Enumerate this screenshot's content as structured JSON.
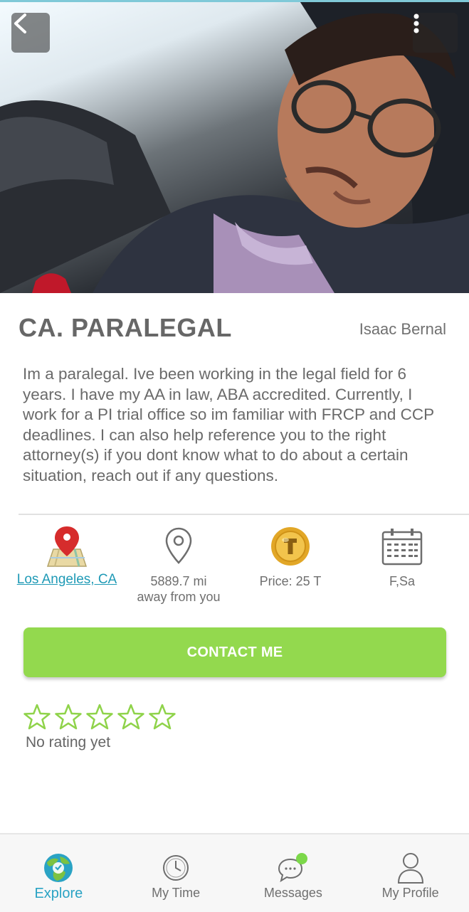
{
  "header": {
    "back_icon": "chevron-left-icon",
    "more_icon": "more-vertical-icon"
  },
  "service": {
    "title": "CA. PARALEGAL",
    "provider": "Isaac Bernal",
    "description": "Im a paralegal. Ive been working in the legal field for 6 years. I have my AA in law, ABA accredited. Currently, I work for a PI trial office so im familiar with FRCP and CCP deadlines. I can also help reference you to the right attorney(s) if you dont know what to do about a certain situation, reach out if any questions."
  },
  "info": {
    "location": "Los Angeles, CA",
    "distance_line1": "5889.7 mi",
    "distance_line2": "away from you",
    "price": "Price: 25 T",
    "days": "F,Sa"
  },
  "contact": {
    "label": "CONTACT ME"
  },
  "rating": {
    "stars_filled": 0,
    "stars_total": 5,
    "text": "No rating yet"
  },
  "nav": {
    "items": [
      {
        "label": "Explore",
        "icon": "explore-globe-icon",
        "active": true
      },
      {
        "label": "My Time",
        "icon": "clock-icon",
        "active": false
      },
      {
        "label": "Messages",
        "icon": "chat-bubble-icon",
        "active": false
      },
      {
        "label": "My Profile",
        "icon": "user-icon",
        "active": false
      }
    ]
  },
  "colors": {
    "accent_green": "#93d94e",
    "link_blue": "#1f9ab6",
    "active_nav": "#2aa3c4",
    "star_outline": "#8fd34a"
  }
}
